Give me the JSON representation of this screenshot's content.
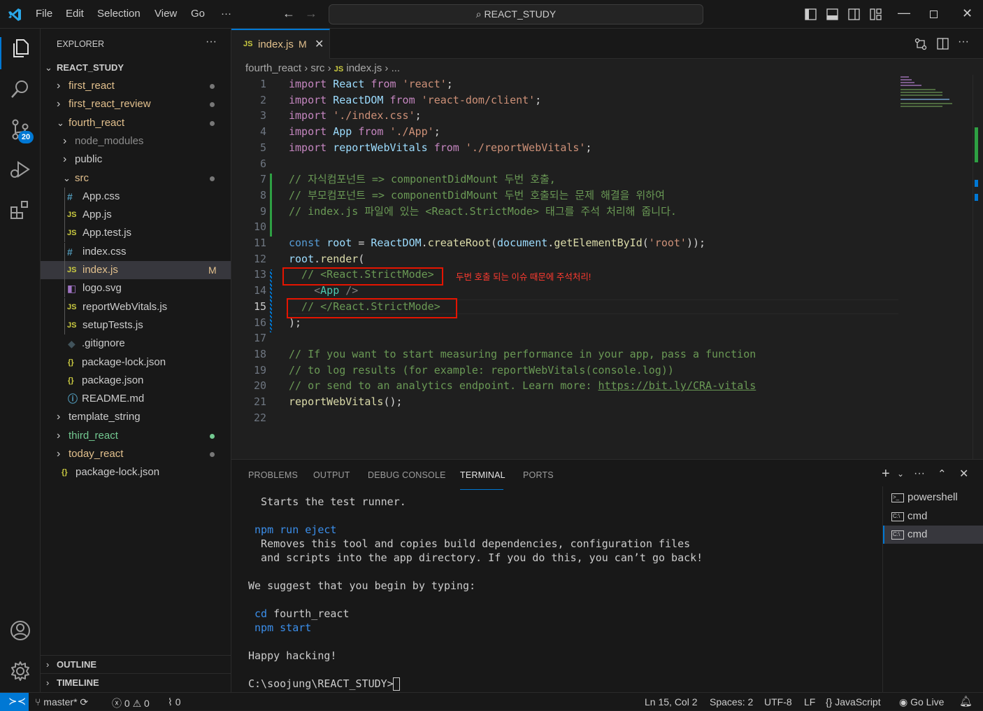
{
  "titlebar": {
    "menus": [
      "File",
      "Edit",
      "Selection",
      "View",
      "Go",
      "···"
    ],
    "search_text": "REACT_STUDY"
  },
  "activity": {
    "badge": "20"
  },
  "sidebar": {
    "header": "EXPLORER",
    "more": "···",
    "root": "REACT_STUDY",
    "items": [
      {
        "label": "first_react",
        "kind": "folder",
        "depth": 0,
        "open": false,
        "dot": true,
        "color": "#e2c08d"
      },
      {
        "label": "first_react_review",
        "kind": "folder",
        "depth": 0,
        "open": false,
        "dot": true,
        "color": "#e2c08d"
      },
      {
        "label": "fourth_react",
        "kind": "folder",
        "depth": 0,
        "open": true,
        "dot": true,
        "color": "#e2c08d"
      },
      {
        "label": "node_modules",
        "kind": "folder",
        "depth": 1,
        "open": false,
        "dot": false,
        "color": "#8c8c8c"
      },
      {
        "label": "public",
        "kind": "folder",
        "depth": 1,
        "open": false,
        "dot": false,
        "color": "#cccccc"
      },
      {
        "label": "src",
        "kind": "folder",
        "depth": 1,
        "open": true,
        "dot": true,
        "color": "#e2c08d"
      },
      {
        "label": "App.css",
        "kind": "css",
        "depth": 2,
        "color": "#cccccc"
      },
      {
        "label": "App.js",
        "kind": "js",
        "depth": 2,
        "color": "#cccccc"
      },
      {
        "label": "App.test.js",
        "kind": "js",
        "depth": 2,
        "color": "#cccccc"
      },
      {
        "label": "index.css",
        "kind": "css",
        "depth": 2,
        "color": "#cccccc"
      },
      {
        "label": "index.js",
        "kind": "js",
        "depth": 2,
        "color": "#e2c08d",
        "badge": "M",
        "selected": true
      },
      {
        "label": "logo.svg",
        "kind": "svg",
        "depth": 2,
        "color": "#cccccc"
      },
      {
        "label": "reportWebVitals.js",
        "kind": "js",
        "depth": 2,
        "color": "#cccccc"
      },
      {
        "label": "setupTests.js",
        "kind": "js",
        "depth": 2,
        "color": "#cccccc"
      },
      {
        "label": ".gitignore",
        "kind": "git",
        "depth": 1,
        "color": "#cccccc"
      },
      {
        "label": "package-lock.json",
        "kind": "json",
        "depth": 1,
        "color": "#cccccc"
      },
      {
        "label": "package.json",
        "kind": "json",
        "depth": 1,
        "color": "#cccccc"
      },
      {
        "label": "README.md",
        "kind": "info",
        "depth": 1,
        "color": "#cccccc"
      },
      {
        "label": "template_string",
        "kind": "folder",
        "depth": 0,
        "open": false,
        "dot": false,
        "color": "#cccccc"
      },
      {
        "label": "third_react",
        "kind": "folder",
        "depth": 0,
        "open": false,
        "dot": true,
        "dotcolor": "#73c991",
        "color": "#73c991"
      },
      {
        "label": "today_react",
        "kind": "folder",
        "depth": 0,
        "open": false,
        "dot": true,
        "color": "#e2c08d"
      },
      {
        "label": "package-lock.json",
        "kind": "json",
        "depth": 0,
        "color": "#cccccc"
      }
    ],
    "outline": "OUTLINE",
    "timeline": "TIMELINE"
  },
  "editor": {
    "tab": {
      "label": "index.js",
      "modified": "M"
    },
    "breadcrumb": [
      "fourth_react",
      "src",
      "index.js",
      "..."
    ],
    "annotation": "두번 호출 되는 이슈 때문에 주석처리!",
    "lines": [
      [
        [
          "import ",
          "kw"
        ],
        [
          "React ",
          "id"
        ],
        [
          "from ",
          "kw"
        ],
        [
          "'react'",
          "st"
        ],
        [
          ";",
          "tx"
        ]
      ],
      [
        [
          "import ",
          "kw"
        ],
        [
          "ReactDOM ",
          "id"
        ],
        [
          "from ",
          "kw"
        ],
        [
          "'react-dom/client'",
          "st"
        ],
        [
          ";",
          "tx"
        ]
      ],
      [
        [
          "import ",
          "kw"
        ],
        [
          "'./index.css'",
          "st"
        ],
        [
          ";",
          "tx"
        ]
      ],
      [
        [
          "import ",
          "kw"
        ],
        [
          "App ",
          "id"
        ],
        [
          "from ",
          "kw"
        ],
        [
          "'./App'",
          "st"
        ],
        [
          ";",
          "tx"
        ]
      ],
      [
        [
          "import ",
          "kw"
        ],
        [
          "reportWebVitals ",
          "id"
        ],
        [
          "from ",
          "kw"
        ],
        [
          "'./reportWebVitals'",
          "st"
        ],
        [
          ";",
          "tx"
        ]
      ],
      [],
      [
        [
          "// 자식컴포넌트 => componentDidMount 두번 호출,",
          "cm"
        ]
      ],
      [
        [
          "// 부모컴포넌트 => componentDidMount 두번 호출되는 문제 해결을 위하여",
          "cm"
        ]
      ],
      [
        [
          "// index.js 파일에 있는 <React.StrictMode> 태그를 주석 처리해 줍니다.",
          "cm"
        ]
      ],
      [],
      [
        [
          "const ",
          "bl"
        ],
        [
          "root ",
          "id"
        ],
        [
          "= ",
          "tx"
        ],
        [
          "ReactDOM",
          "id"
        ],
        [
          ".",
          "tx"
        ],
        [
          "createRoot",
          "fn"
        ],
        [
          "(",
          "tx"
        ],
        [
          "document",
          "id"
        ],
        [
          ".",
          "tx"
        ],
        [
          "getElementById",
          "fn"
        ],
        [
          "(",
          "tx"
        ],
        [
          "'root'",
          "st"
        ],
        [
          "));",
          "tx"
        ]
      ],
      [
        [
          "root",
          "id"
        ],
        [
          ".",
          "tx"
        ],
        [
          "render",
          "fn"
        ],
        [
          "(",
          "tx"
        ]
      ],
      [
        [
          "  // <React.StrictMode>",
          "cm"
        ]
      ],
      [
        [
          "    ",
          "tx"
        ],
        [
          "<",
          "gy"
        ],
        [
          "App ",
          "tg"
        ],
        [
          "/>",
          "gy"
        ]
      ],
      [
        [
          "  // </React.StrictMode>",
          "cm"
        ]
      ],
      [
        [
          ")",
          "tx"
        ],
        [
          ";",
          "tx"
        ]
      ],
      [],
      [
        [
          "// If you want to start measuring performance in your app, pass a function",
          "cm"
        ]
      ],
      [
        [
          "// to log results (for example: reportWebVitals(console.log))",
          "cm"
        ]
      ],
      [
        [
          "// or send to an analytics endpoint. Learn more: ",
          "cm"
        ],
        [
          "https://bit.ly/CRA-vitals",
          "cmu"
        ]
      ],
      [
        [
          "reportWebVitals",
          "fn"
        ],
        [
          "();",
          "tx"
        ]
      ],
      []
    ]
  },
  "panel": {
    "tabs": [
      "PROBLEMS",
      "OUTPUT",
      "DEBUG CONSOLE",
      "TERMINAL",
      "PORTS"
    ],
    "active_tab": "TERMINAL",
    "terminal": [
      {
        "text": "  Starts the test runner.",
        "c": "#cccccc"
      },
      {
        "text": "",
        "c": "#cccccc"
      },
      {
        "text": " npm run eject",
        "c": "#3b8eea"
      },
      {
        "text": "  Removes this tool and copies build dependencies, configuration files",
        "c": "#cccccc"
      },
      {
        "text": "  and scripts into the app directory. If you do this, you can’t go back!",
        "c": "#cccccc"
      },
      {
        "text": "",
        "c": "#cccccc"
      },
      {
        "text": "We suggest that you begin by typing:",
        "c": "#cccccc"
      },
      {
        "text": "",
        "c": "#cccccc"
      },
      {
        "text": " cd fourth_react",
        "c": "#cccccc",
        "hl": "cd"
      },
      {
        "text": " npm start",
        "c": "#3b8eea"
      },
      {
        "text": "",
        "c": "#cccccc"
      },
      {
        "text": "Happy hacking!",
        "c": "#cccccc"
      },
      {
        "text": "",
        "c": "#cccccc"
      },
      {
        "text": "C:\\soojung\\REACT_STUDY>",
        "c": "#cccccc"
      }
    ],
    "terminals": [
      "powershell",
      "cmd",
      "cmd"
    ]
  },
  "status": {
    "branch": "master*",
    "errors": "0",
    "warnings": "0",
    "ports": "0",
    "position": "Ln 15, Col 2",
    "spaces": "Spaces: 2",
    "encoding": "UTF-8",
    "eol": "LF",
    "language": "JavaScript",
    "golive": "Go Live"
  }
}
